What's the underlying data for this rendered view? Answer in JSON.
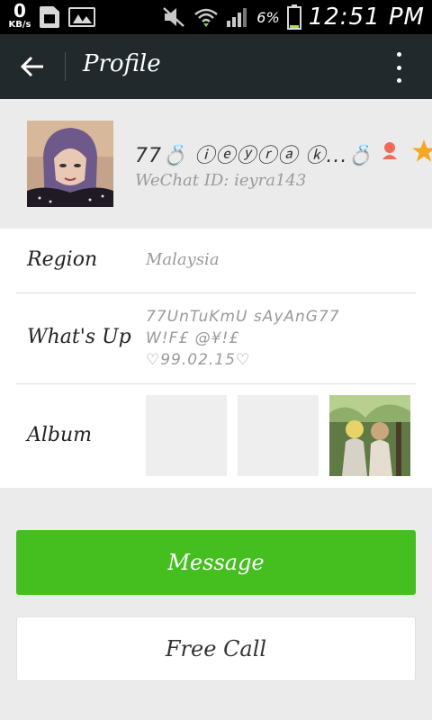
{
  "status_bar": {
    "speed_value": "0",
    "speed_unit": "KB/s",
    "battery_percent": "6%",
    "time": "12:51 PM",
    "icons": [
      "sim-icon",
      "gallery-icon",
      "mute-icon",
      "wifi-icon",
      "signal-icon",
      "battery-icon"
    ],
    "battery_level": 0.06,
    "battery_color": "#a8e04a"
  },
  "app_bar": {
    "title": "Profile",
    "back_icon": "arrow-left-icon",
    "more_icon": "more-vertical-icon",
    "background": "#22292c"
  },
  "profile": {
    "name": "77💍 ⓘⓔⓨⓡⓐ ⓚ...💍",
    "wechat_id": "WeChat ID: ieyra143",
    "gender_icon": "female-icon",
    "star_icon": "star-icon"
  },
  "details": {
    "region": {
      "label": "Region",
      "value": "Malaysia"
    },
    "whats_up": {
      "label": "What's Up",
      "value": "77UnTuKmU sAyAnG77\nW!F£ @¥!£\n♡99.02.15♡"
    },
    "album": {
      "label": "Album"
    }
  },
  "buttons": {
    "message": "Message",
    "free_call": "Free Call"
  },
  "colors": {
    "accent": "#45bf20",
    "page_background": "#ebebeb"
  }
}
